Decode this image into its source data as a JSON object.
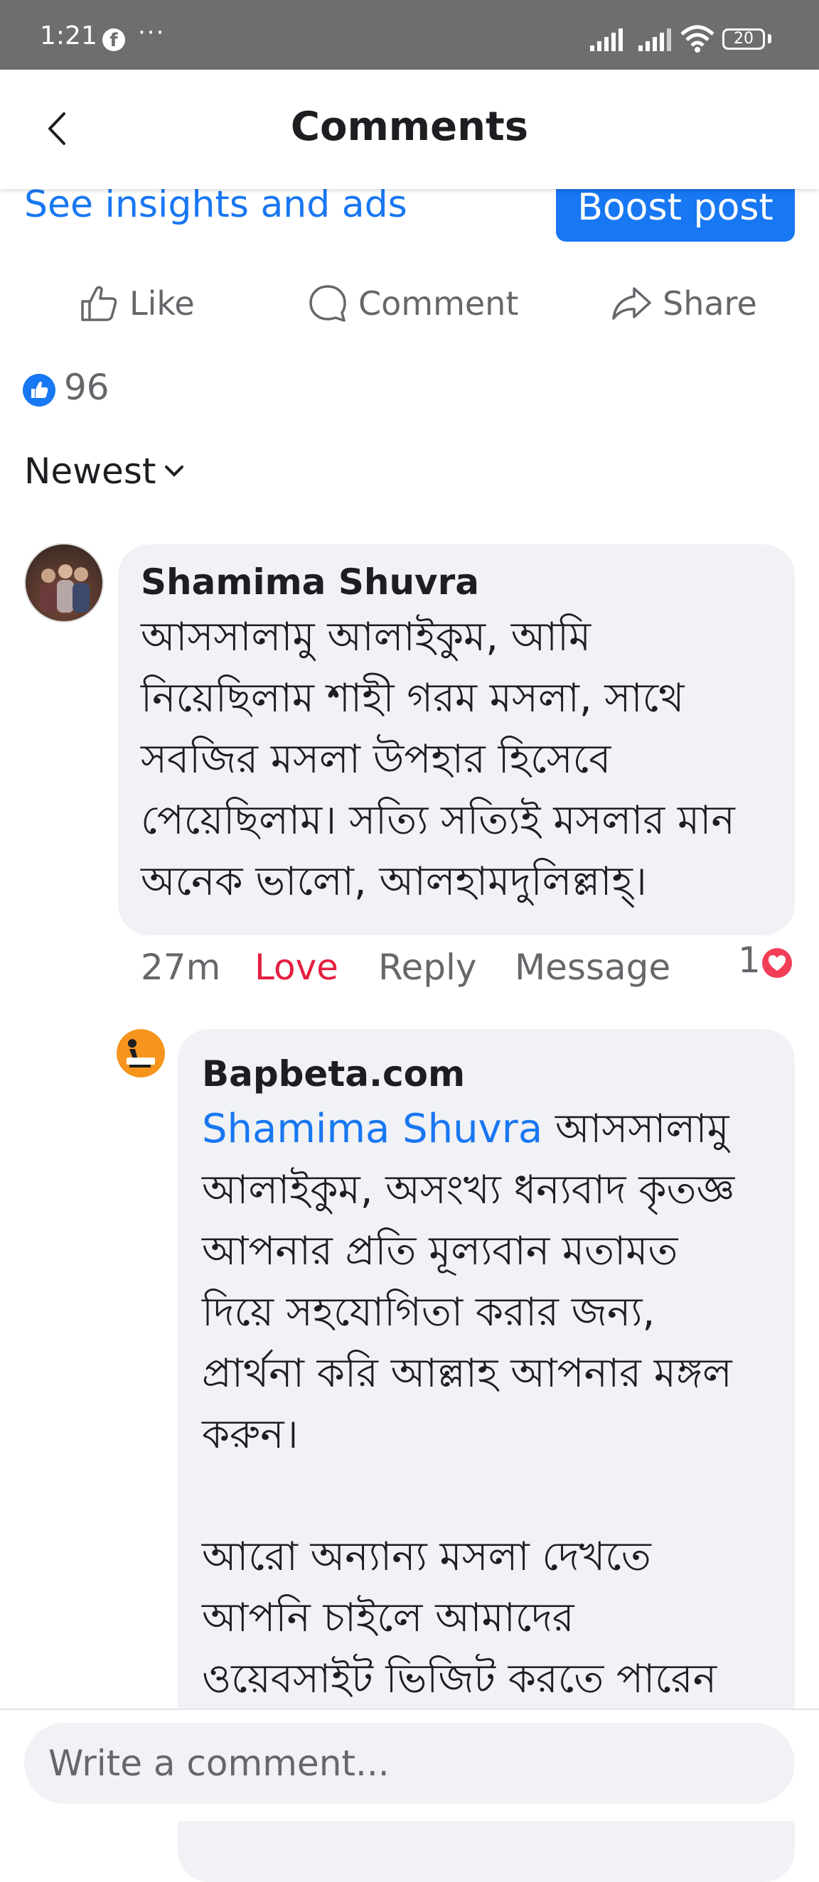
{
  "status_bar": {
    "time": "1:21",
    "dots": "···",
    "battery": "20",
    "icons": [
      "facebook-icon",
      "signal-icon",
      "signal-icon",
      "wifi-icon",
      "battery-icon"
    ]
  },
  "header": {
    "title": "Comments",
    "back_icon": "chevron-left-icon"
  },
  "post": {
    "insights_link": "See insights and ads",
    "boost_label": "Boost post",
    "actions": [
      {
        "label": "Like",
        "icon": "thumbs-up-icon"
      },
      {
        "label": "Comment",
        "icon": "comment-bubble-icon"
      },
      {
        "label": "Share",
        "icon": "share-arrow-icon"
      }
    ],
    "reaction_count": "96",
    "sort_label": "Newest"
  },
  "comments": [
    {
      "author": "Shamima Shuvra",
      "text": "আসসালামু আলাইকুম, আমি\nনিয়েছিলাম শাহী গরম মসলা, সাথে\nসবজির মসলা উপহার হিসেবে\nপেয়েছিলাম। সত্যি সত্যিই মসলার মান\nঅনেক ভালো, আলহামদুলিল্লাহ্।",
      "time": "27m",
      "love_label": "Love",
      "reply_label": "Reply",
      "message_label": "Message",
      "reaction_count": "1"
    }
  ],
  "reply": {
    "author": "Bapbeta.com",
    "mention": "Shamima Shuvra",
    "text": " আসসালামু\nআলাইকুম, অসংখ্য ধন্যবাদ কৃতজ্ঞ\nআপনার প্রতি মূল্যবান মতামত\nদিয়ে সহযোগিতা করার জন্য,\nপ্রার্থনা করি আল্লাহ আপনার মঙ্গল\nকরুন।\n\nআরো অন্যান্য মসলা দেখতে\nআপনি চাইলে আমাদের\nওয়েবসাইট ভিজিট করতে পারেন"
  },
  "composer": {
    "placeholder": "Write a comment..."
  },
  "colors": {
    "accent": "#1877f2",
    "love": "#e41e3f",
    "bubble": "#f0f2f5",
    "status_bar": "#6e6e6e"
  }
}
